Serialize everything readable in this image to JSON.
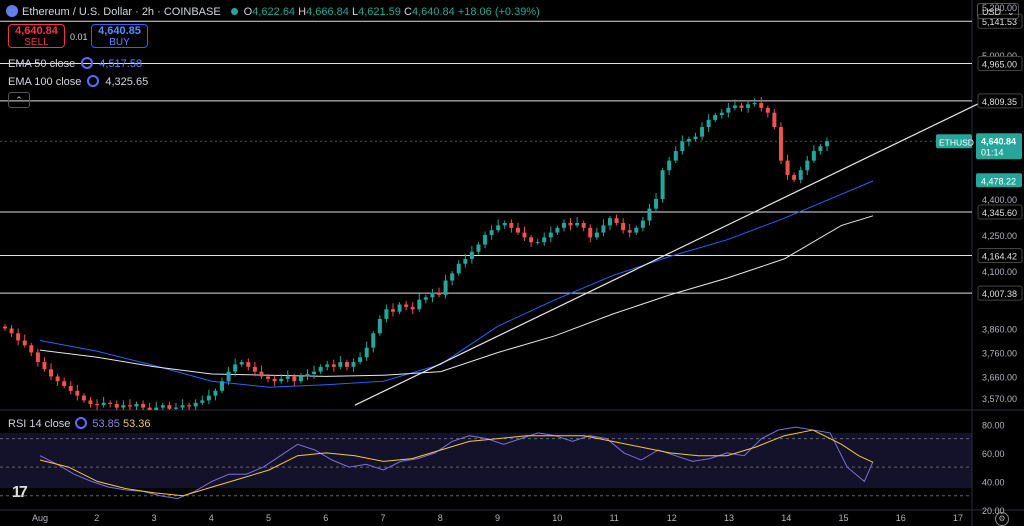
{
  "header": {
    "symbol": "Ethereum / U.S. Dollar · 2h · COINBASE",
    "o_label": "O",
    "o": "4,622.64",
    "h_label": "H",
    "h": "4,666.84",
    "l_label": "L",
    "l": "4,621.59",
    "c_label": "C",
    "c": "4,640.84",
    "change": "+18.06 (+0.39%)"
  },
  "trade": {
    "sell_price": "4,640.84",
    "sell_label": "SELL",
    "spread": "0.01",
    "buy_price": "4,640.85",
    "buy_label": "BUY"
  },
  "indicators": [
    {
      "label": "EMA 50 close",
      "value": "4,517.58"
    },
    {
      "label": "EMA 100 close",
      "value": "4,325.65"
    }
  ],
  "currency": "USD",
  "rsi": {
    "label": "RSI 14 close",
    "value1": "53.85",
    "value2": "53.36"
  },
  "colors": {
    "up": "#26a69a",
    "down": "#ef5350",
    "ema50": "#2962ff",
    "ema100": "#e6e6e6",
    "rsi": "#7b6fd6",
    "rsi_ma": "#f5c542",
    "accent": "#5b8cff"
  },
  "chart_data": [
    {
      "type": "candlestick",
      "title": "Ethereum / U.S. Dollar · 2h · COINBASE",
      "x_ticks": [
        "Aug",
        "2",
        "3",
        "4",
        "5",
        "6",
        "7",
        "8",
        "9",
        "10",
        "11",
        "12",
        "13",
        "14",
        "15",
        "16",
        "17"
      ],
      "y_ticks": [
        "5,200.00",
        "5,000.00",
        "4,400.00",
        "4,250.00",
        "4,100.00",
        "3,860.00",
        "3,760.00",
        "3,660.00",
        "3,570.00"
      ],
      "ylim": [
        3520,
        5230
      ],
      "current_price": {
        "symbol": "ETHUSD",
        "value": "4,640.84",
        "countdown": "01:14"
      },
      "price_tags": [
        "4,478.22"
      ],
      "horizontal_levels": [
        "5,141.53",
        "4,965.00",
        "4,809.35",
        "4,345.60",
        "4,164.42",
        "4,007.38"
      ],
      "series": [
        {
          "name": "EMA 50 close",
          "color": "#2962ff",
          "points": [
            [
              0,
              3810
            ],
            [
              1,
              3765
            ],
            [
              2,
              3705
            ],
            [
              3,
              3640
            ],
            [
              4,
              3615
            ],
            [
              5,
              3625
            ],
            [
              6,
              3640
            ],
            [
              7,
              3710
            ],
            [
              8,
              3870
            ],
            [
              9,
              3980
            ],
            [
              10,
              4080
            ],
            [
              11,
              4160
            ],
            [
              12,
              4230
            ],
            [
              13,
              4320
            ],
            [
              14,
              4420
            ],
            [
              14.55,
              4475
            ]
          ]
        },
        {
          "name": "EMA 100 close",
          "color": "#e6e6e6",
          "points": [
            [
              0,
              3770
            ],
            [
              1,
              3740
            ],
            [
              2,
              3700
            ],
            [
              3,
              3670
            ],
            [
              4,
              3665
            ],
            [
              5,
              3660
            ],
            [
              6,
              3665
            ],
            [
              7,
              3680
            ],
            [
              8,
              3760
            ],
            [
              9,
              3830
            ],
            [
              10,
              3920
            ],
            [
              11,
              4000
            ],
            [
              12,
              4070
            ],
            [
              13,
              4150
            ],
            [
              14,
              4290
            ],
            [
              14.55,
              4330
            ]
          ]
        }
      ],
      "trendline": [
        [
          5.5,
          3540
        ],
        [
          16.5,
          4810
        ]
      ],
      "closes": [
        3860,
        3840,
        3810,
        3790,
        3760,
        3720,
        3690,
        3660,
        3640,
        3620,
        3600,
        3580,
        3560,
        3545,
        3540,
        3550,
        3545,
        3530,
        3540,
        3535,
        3545,
        3530,
        3520,
        3530,
        3540,
        3525,
        3530,
        3540,
        3535,
        3550,
        3560,
        3580,
        3600,
        3640,
        3680,
        3710,
        3720,
        3700,
        3680,
        3660,
        3650,
        3640,
        3650,
        3660,
        3640,
        3660,
        3670,
        3680,
        3700,
        3710,
        3700,
        3720,
        3700,
        3720,
        3740,
        3780,
        3840,
        3900,
        3940,
        3930,
        3960,
        3950,
        3940,
        3980,
        3990,
        4010,
        4000,
        4060,
        4090,
        4130,
        4150,
        4180,
        4210,
        4250,
        4270,
        4290,
        4300,
        4280,
        4260,
        4240,
        4220,
        4220,
        4240,
        4260,
        4280,
        4300,
        4290,
        4300,
        4280,
        4240,
        4260,
        4290,
        4320,
        4300,
        4270,
        4260,
        4280,
        4310,
        4360,
        4400,
        4520,
        4560,
        4600,
        4640,
        4650,
        4660,
        4700,
        4730,
        4750,
        4760,
        4780,
        4790,
        4780,
        4795,
        4800,
        4780,
        4760,
        4700,
        4560,
        4500,
        4480,
        4520,
        4560,
        4600,
        4620,
        4641
      ]
    },
    {
      "type": "line",
      "title": "RSI 14 close",
      "ylim": [
        20,
        90
      ],
      "y_ticks": [
        "80.00",
        "60.00",
        "40.00",
        "20.00"
      ],
      "bands": [
        70,
        50,
        30
      ],
      "series": [
        {
          "name": "RSI 14 close",
          "color": "#7b6fd6",
          "points": [
            [
              0,
              58
            ],
            [
              0.3,
              52
            ],
            [
              0.6,
              45
            ],
            [
              0.9,
              40
            ],
            [
              1.2,
              36
            ],
            [
              1.5,
              34
            ],
            [
              1.8,
              33
            ],
            [
              2.1,
              30
            ],
            [
              2.4,
              28
            ],
            [
              2.7,
              33
            ],
            [
              3.0,
              40
            ],
            [
              3.3,
              45
            ],
            [
              3.6,
              45
            ],
            [
              3.9,
              50
            ],
            [
              4.2,
              58
            ],
            [
              4.5,
              66
            ],
            [
              4.8,
              62
            ],
            [
              5.1,
              55
            ],
            [
              5.4,
              50
            ],
            [
              5.7,
              52
            ],
            [
              6.0,
              48
            ],
            [
              6.3,
              54
            ],
            [
              6.6,
              56
            ],
            [
              6.9,
              60
            ],
            [
              7.2,
              68
            ],
            [
              7.5,
              72
            ],
            [
              7.8,
              70
            ],
            [
              8.1,
              66
            ],
            [
              8.4,
              70
            ],
            [
              8.7,
              74
            ],
            [
              9.0,
              72
            ],
            [
              9.3,
              68
            ],
            [
              9.6,
              72
            ],
            [
              9.9,
              70
            ],
            [
              10.2,
              60
            ],
            [
              10.5,
              55
            ],
            [
              10.8,
              62
            ],
            [
              11.1,
              58
            ],
            [
              11.4,
              54
            ],
            [
              11.7,
              56
            ],
            [
              12.0,
              60
            ],
            [
              12.3,
              58
            ],
            [
              12.6,
              70
            ],
            [
              12.9,
              76
            ],
            [
              13.2,
              78
            ],
            [
              13.5,
              76
            ],
            [
              13.8,
              74
            ],
            [
              14.1,
              50
            ],
            [
              14.4,
              40
            ],
            [
              14.55,
              53.85
            ]
          ]
        },
        {
          "name": "RSI MA",
          "color": "#f5c542",
          "points": [
            [
              0,
              55
            ],
            [
              0.5,
              50
            ],
            [
              1.0,
              40
            ],
            [
              1.5,
              35
            ],
            [
              2.0,
              32
            ],
            [
              2.5,
              30
            ],
            [
              3.0,
              36
            ],
            [
              3.5,
              42
            ],
            [
              4.0,
              48
            ],
            [
              4.5,
              58
            ],
            [
              5.0,
              60
            ],
            [
              5.5,
              58
            ],
            [
              6.0,
              54
            ],
            [
              6.5,
              56
            ],
            [
              7.0,
              62
            ],
            [
              7.5,
              68
            ],
            [
              8.0,
              70
            ],
            [
              8.5,
              72
            ],
            [
              9.0,
              72
            ],
            [
              9.5,
              72
            ],
            [
              10.0,
              68
            ],
            [
              10.5,
              64
            ],
            [
              11.0,
              60
            ],
            [
              11.5,
              58
            ],
            [
              12.0,
              58
            ],
            [
              12.5,
              64
            ],
            [
              13.0,
              72
            ],
            [
              13.5,
              76
            ],
            [
              14.0,
              66
            ],
            [
              14.3,
              58
            ],
            [
              14.55,
              53.36
            ]
          ]
        }
      ]
    }
  ]
}
